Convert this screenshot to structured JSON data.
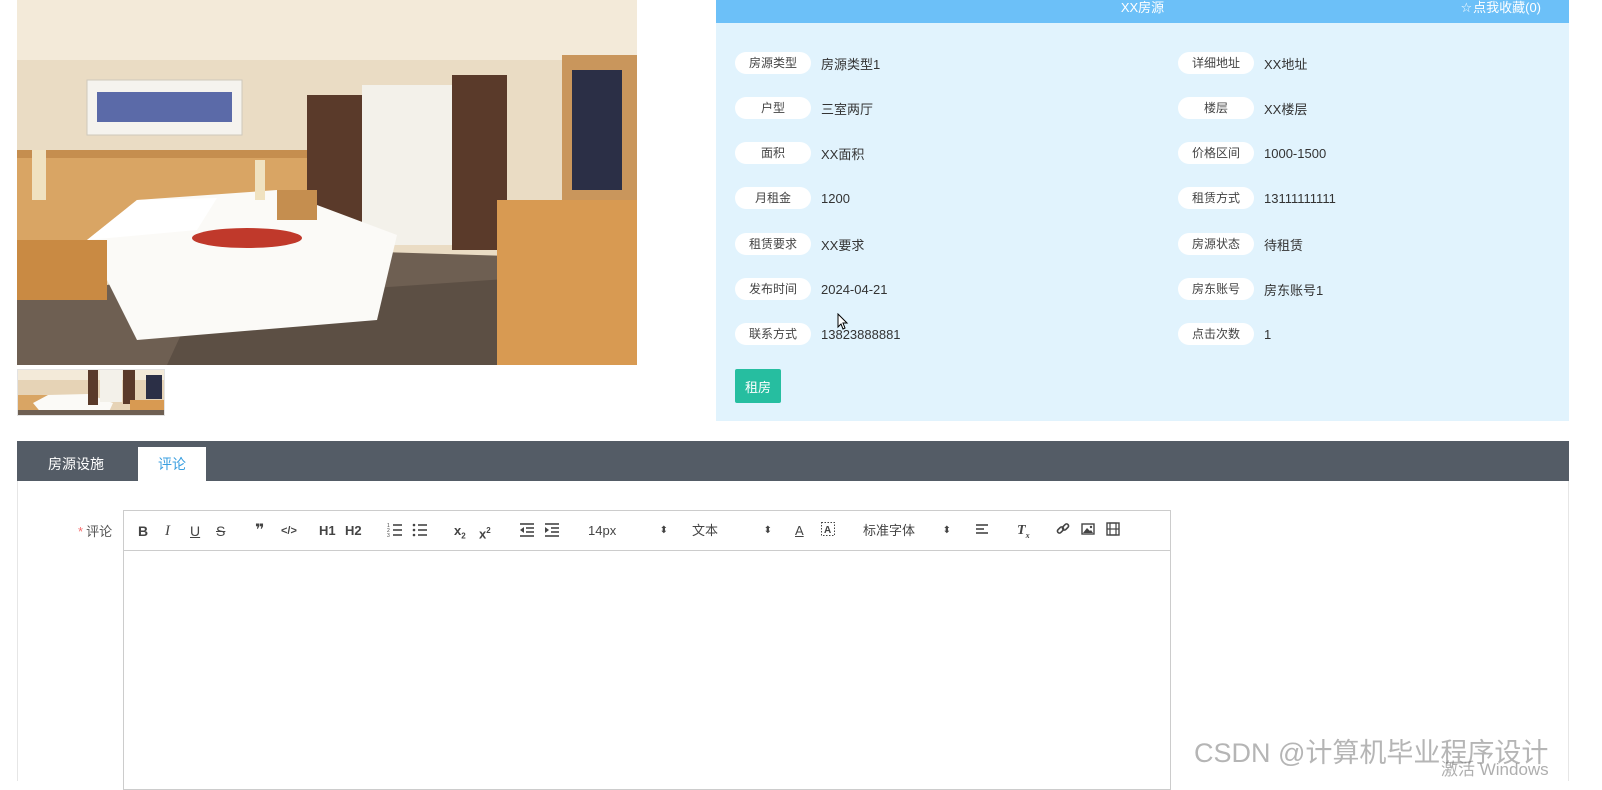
{
  "house": {
    "title": "XX房源",
    "favorite_label": "点我收藏(0)",
    "favorite_icon": "star-outline-icon"
  },
  "fields_left": [
    {
      "label": "房源类型",
      "value": "房源类型1"
    },
    {
      "label": "户型",
      "value": "三室两厅"
    },
    {
      "label": "面积",
      "value": "XX面积"
    },
    {
      "label": "月租金",
      "value": "1200"
    },
    {
      "label": "租赁要求",
      "value": "XX要求"
    },
    {
      "label": "发布时间",
      "value": "2024-04-21"
    },
    {
      "label": "联系方式",
      "value": "13823888881"
    }
  ],
  "fields_right": [
    {
      "label": "详细地址",
      "value": "XX地址"
    },
    {
      "label": "楼层",
      "value": "XX楼层"
    },
    {
      "label": "价格区间",
      "value": "1000-1500"
    },
    {
      "label": "租赁方式",
      "value": "13111111111"
    },
    {
      "label": "房源状态",
      "value": "待租赁"
    },
    {
      "label": "房东账号",
      "value": "房东账号1"
    },
    {
      "label": "点击次数",
      "value": "1"
    }
  ],
  "rent_button": "租房",
  "tabs": [
    {
      "label": "房源设施",
      "active": false
    },
    {
      "label": "评论",
      "active": true
    }
  ],
  "comment_form": {
    "required_mark": "*",
    "label": "评论"
  },
  "toolbar": {
    "font_size": "14px",
    "heading": "文本",
    "font_family": "标准字体",
    "h1": "H1",
    "h2": "H2"
  },
  "watermark": "CSDN @计算机毕业程序设计",
  "os_notice": "激活 Windows",
  "colors": {
    "header_blue": "#6cc0f8",
    "panel_bg": "#e1f3fd",
    "rent_green": "#26bea0",
    "tabbar_gray": "#545c66",
    "active_tab_text": "#3a9fe0"
  }
}
